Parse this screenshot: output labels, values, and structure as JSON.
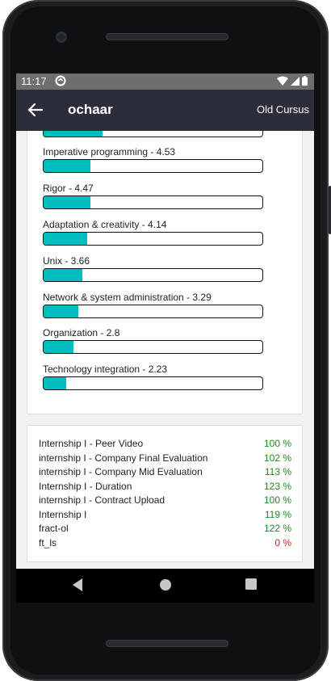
{
  "status": {
    "time": "11:17"
  },
  "appbar": {
    "title": "ochaar",
    "action": "Old Cursus"
  },
  "skills": [
    {
      "label": "",
      "level": 0.27
    },
    {
      "label": "Imperative programming - 4.53",
      "level": 0.215
    },
    {
      "label": "Rigor - 4.47",
      "level": 0.215
    },
    {
      "label": "Adaptation & creativity - 4.14",
      "level": 0.2
    },
    {
      "label": "Unix - 3.66",
      "level": 0.178
    },
    {
      "label": "Network & system administration - 3.29",
      "level": 0.16
    },
    {
      "label": "Organization - 2.8",
      "level": 0.135
    },
    {
      "label": "Technology integration - 2.23",
      "level": 0.105
    }
  ],
  "projects": [
    {
      "name": "Internship I - Peer Video",
      "value": "100 %",
      "color": "#1e8c1e"
    },
    {
      "name": "internship I - Company Final Evaluation",
      "value": "102 %",
      "color": "#1e8c1e"
    },
    {
      "name": "internship I - Company Mid Evaluation",
      "value": "113 %",
      "color": "#1e8c1e"
    },
    {
      "name": "Internship I - Duration",
      "value": "123 %",
      "color": "#1e8c1e"
    },
    {
      "name": "internship I - Contract Upload",
      "value": "100 %",
      "color": "#1e8c1e"
    },
    {
      "name": "Internship I",
      "value": "119 %",
      "color": "#1e8c1e"
    },
    {
      "name": "fract-ol",
      "value": "122 %",
      "color": "#1e8c1e"
    },
    {
      "name": "ft_ls",
      "value": "0 %",
      "color": "#e02020"
    }
  ],
  "colors": {
    "accent": "#00bdc0",
    "appbar": "#2c2d3a"
  },
  "icons": {
    "back": "arrow-left-icon",
    "wifi": "wifi-icon",
    "signal": "signal-icon",
    "battery": "battery-icon"
  }
}
